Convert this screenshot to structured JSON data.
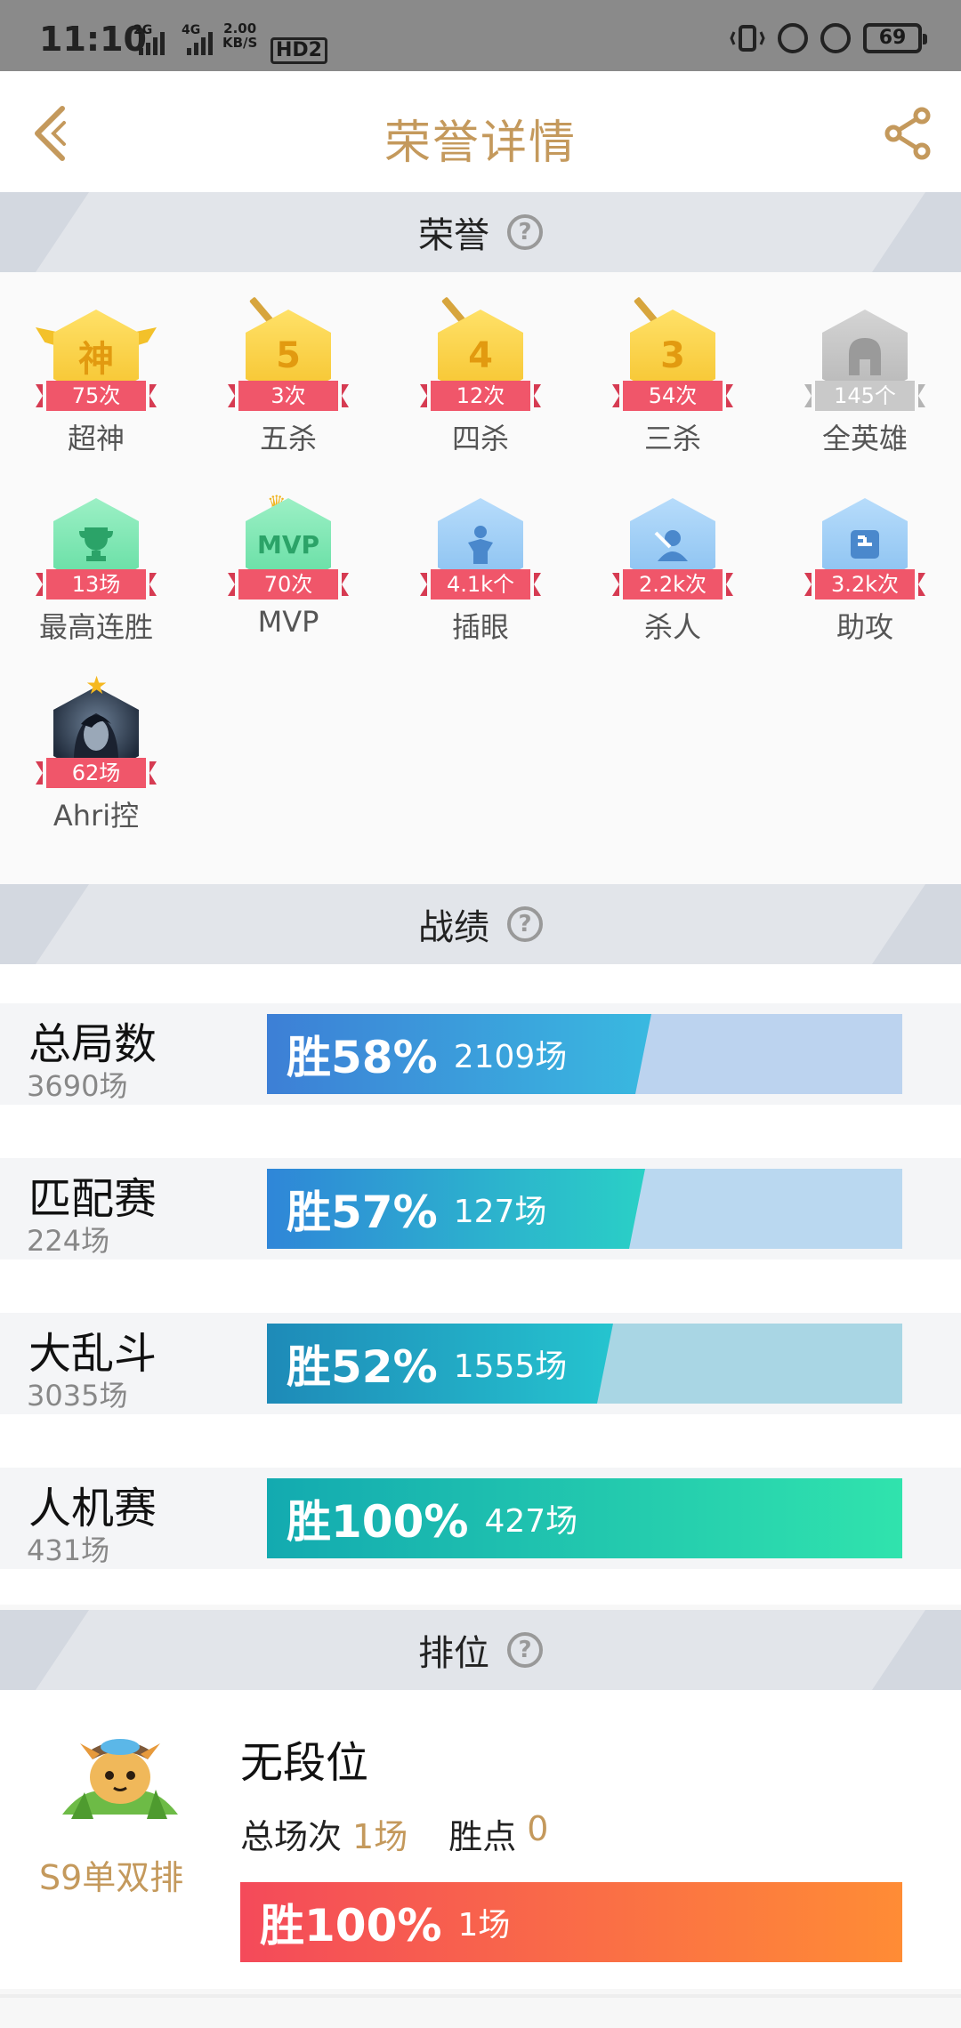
{
  "status_bar": {
    "time": "11:10",
    "sim1_net": "2G",
    "sim2_net": "4G",
    "speed_value": "2.00",
    "speed_unit": "KB/S",
    "hd_label": "HD2",
    "battery": "69"
  },
  "header": {
    "title": "荣誉详情"
  },
  "sections": {
    "honor": "荣誉",
    "record": "战绩",
    "rank": "排位",
    "help_glyph": "?"
  },
  "honors": [
    {
      "badge_glyph": "神",
      "count": "75次",
      "label": "超神",
      "style": "gold",
      "decor": "wings"
    },
    {
      "badge_glyph": "5",
      "count": "3次",
      "label": "五杀",
      "style": "gold",
      "decor": "sword"
    },
    {
      "badge_glyph": "4",
      "count": "12次",
      "label": "四杀",
      "style": "gold",
      "decor": "sword"
    },
    {
      "badge_glyph": "3",
      "count": "54次",
      "label": "三杀",
      "style": "gold",
      "decor": "sword"
    },
    {
      "badge_glyph": "",
      "count": "145个",
      "label": "全英雄",
      "style": "silver",
      "decor": "helmet"
    },
    {
      "badge_glyph": "",
      "count": "13场",
      "label": "最高连胜",
      "style": "green",
      "decor": "trophy"
    },
    {
      "badge_glyph": "MVP",
      "count": "70次",
      "label": "MVP",
      "style": "green",
      "decor": "crown"
    },
    {
      "badge_glyph": "",
      "count": "4.1k个",
      "label": "插眼",
      "style": "blue",
      "decor": "ward"
    },
    {
      "badge_glyph": "",
      "count": "2.2k次",
      "label": "杀人",
      "style": "blue",
      "decor": "kill"
    },
    {
      "badge_glyph": "",
      "count": "3.2k次",
      "label": "助攻",
      "style": "blue",
      "decor": "fist"
    },
    {
      "badge_glyph": "",
      "count": "62场",
      "label": "Ahri控",
      "style": "avatar",
      "decor": "star"
    }
  ],
  "records": [
    {
      "name": "总局数",
      "total": "3690场",
      "win_label": "胜58%",
      "win_games": "2109场",
      "win_rate": 0.58,
      "fill_from": "#3d7fd6",
      "fill_to": "#39b9e0",
      "track": "#bcd3ef"
    },
    {
      "name": "匹配赛",
      "total": "224场",
      "win_label": "胜57%",
      "win_games": "127场",
      "win_rate": 0.57,
      "fill_from": "#2f86d8",
      "fill_to": "#2ad0c6",
      "track": "#bad8f0"
    },
    {
      "name": "大乱斗",
      "total": "3035场",
      "win_label": "胜52%",
      "win_games": "1555场",
      "win_rate": 0.52,
      "fill_from": "#1e8ab8",
      "fill_to": "#25c4cf",
      "track": "#a9d6e4"
    },
    {
      "name": "人机赛",
      "total": "431场",
      "win_label": "胜100%",
      "win_games": "427场",
      "win_rate": 1.0,
      "fill_from": "#13aab0",
      "fill_to": "#30e3ad",
      "track": "#b5ecdc"
    }
  ],
  "rank": {
    "season": "S9单双排",
    "tier": "无段位",
    "games_label": "总场次",
    "games_value": "1场",
    "lp_label": "胜点",
    "lp_value": "0",
    "win_label": "胜100%",
    "win_games": "1场"
  },
  "colors": {
    "accent": "#c4995c",
    "ribbon": "#f0566a"
  }
}
